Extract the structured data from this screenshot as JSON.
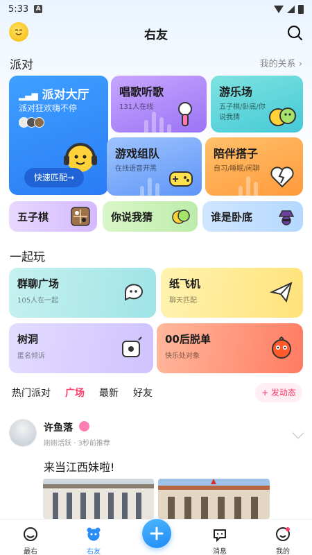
{
  "status_bar": {
    "time": "5:33",
    "notification_letter": "A"
  },
  "header": {
    "title": "右友"
  },
  "party": {
    "section_title": "派对",
    "relation_link": "我的关系 ›",
    "big_card": {
      "title": "派对大厅",
      "subtitle": "派对狂欢嗨不停",
      "button": "快速匹配→"
    },
    "sing_card": {
      "title": "唱歌听歌",
      "subtitle": "131人在线"
    },
    "fun_card": {
      "title": "游乐场",
      "subtitle": "五子棋/卧底/你说我猜"
    },
    "game_card": {
      "title": "游戏组队",
      "subtitle": "在线语音开黑"
    },
    "partner_card": {
      "title": "陪伴搭子",
      "subtitle": "自习/睡眠/闲聊"
    },
    "tiles": [
      {
        "label": "五子棋"
      },
      {
        "label": "你说我猜"
      },
      {
        "label": "谁是卧底"
      }
    ]
  },
  "play": {
    "section_title": "一起玩",
    "cards": [
      {
        "title": "群聊广场",
        "subtitle": "105人在一起"
      },
      {
        "title": "纸飞机",
        "subtitle": "聊天匹配"
      },
      {
        "title": "树洞",
        "subtitle": "匿名倾诉"
      },
      {
        "title": "00后脱单",
        "subtitle": "快乐处对象"
      }
    ]
  },
  "feed_tabs": {
    "tabs": [
      "热门派对",
      "广场",
      "最新",
      "好友"
    ],
    "active_tab": "广场",
    "post_button": "+ 发动态"
  },
  "post": {
    "author": "许鱼落",
    "meta": "刚刚活跃 · 3秒前推荐",
    "text": "来当江西妹啦!"
  },
  "bottom_nav": {
    "items": [
      {
        "label": "最右"
      },
      {
        "label": "右友"
      },
      {
        "label": "消息"
      },
      {
        "label": "我的"
      }
    ],
    "active": "右友"
  },
  "colors": {
    "accent_blue": "#2a8cf6",
    "accent_pink": "#ff3b6b"
  }
}
